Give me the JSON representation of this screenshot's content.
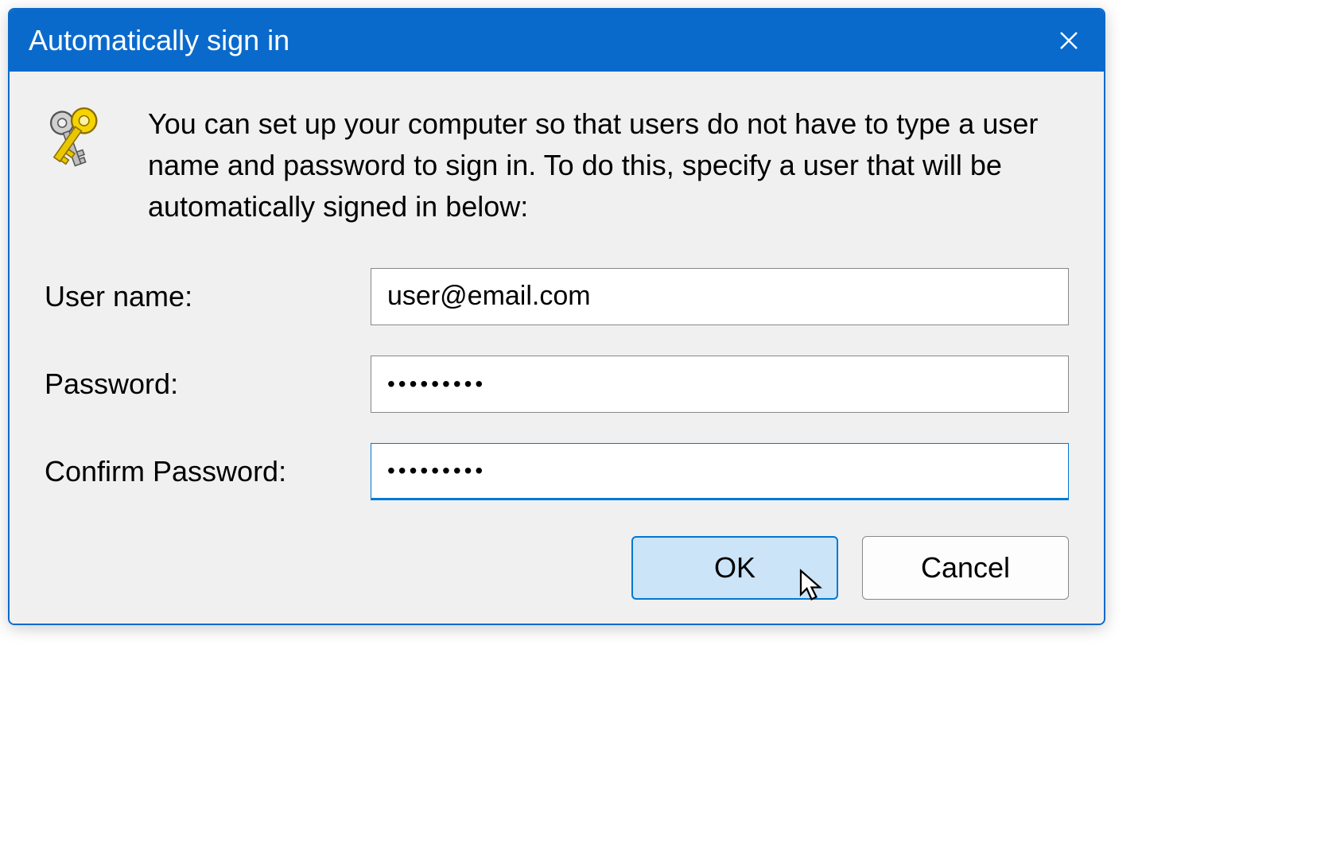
{
  "dialog": {
    "title": "Automatically sign in",
    "description": "You can set up your computer so that users do not have to type a user name and password to sign in. To do this, specify a user that will be automatically signed in below:",
    "fields": {
      "username": {
        "label": "User name:",
        "value": "user@email.com"
      },
      "password": {
        "label": "Password:",
        "value": "•••••••••"
      },
      "confirm": {
        "label": "Confirm Password:",
        "value": "•••••••••"
      }
    },
    "buttons": {
      "ok": "OK",
      "cancel": "Cancel"
    }
  }
}
